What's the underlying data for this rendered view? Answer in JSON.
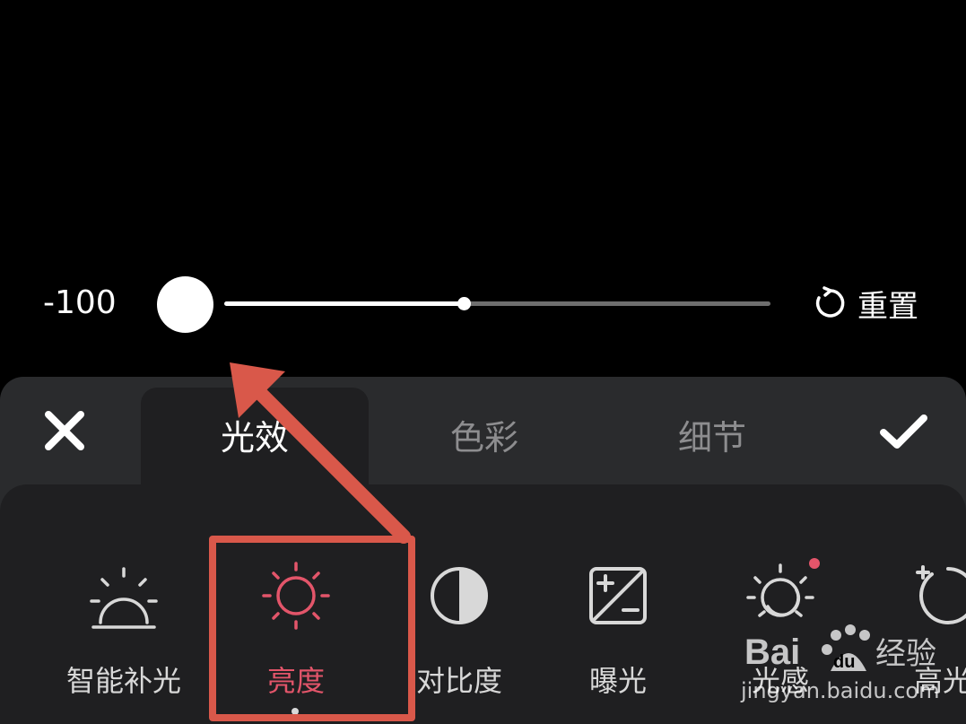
{
  "slider": {
    "value_text": "-100",
    "position_fraction": 0.0,
    "center_fraction": 0.5
  },
  "reset": {
    "label": "重置",
    "icon": "reset-icon"
  },
  "tabs": [
    {
      "label": "光效",
      "active": true
    },
    {
      "label": "色彩",
      "active": false
    },
    {
      "label": "细节",
      "active": false
    }
  ],
  "actions": {
    "close_icon": "close-icon",
    "confirm_icon": "checkmark-icon"
  },
  "tools": [
    {
      "label": "智能补光",
      "icon": "sunrise-icon"
    },
    {
      "label": "亮度",
      "icon": "sun-icon",
      "active": true
    },
    {
      "label": "对比度",
      "icon": "contrast-icon"
    },
    {
      "label": "曝光",
      "icon": "exposure-icon"
    },
    {
      "label": "光感",
      "icon": "light-feel-icon",
      "badge": true
    },
    {
      "label": "高光",
      "icon": "highlight-icon"
    }
  ],
  "colors": {
    "accent": "#e3556a",
    "annotation": "#d9584a",
    "panel": "#2a2b2d",
    "tool_area": "#1f1f21"
  },
  "watermark": {
    "brand": "Bai du 经验",
    "url": "jingyan.baidu.com"
  }
}
